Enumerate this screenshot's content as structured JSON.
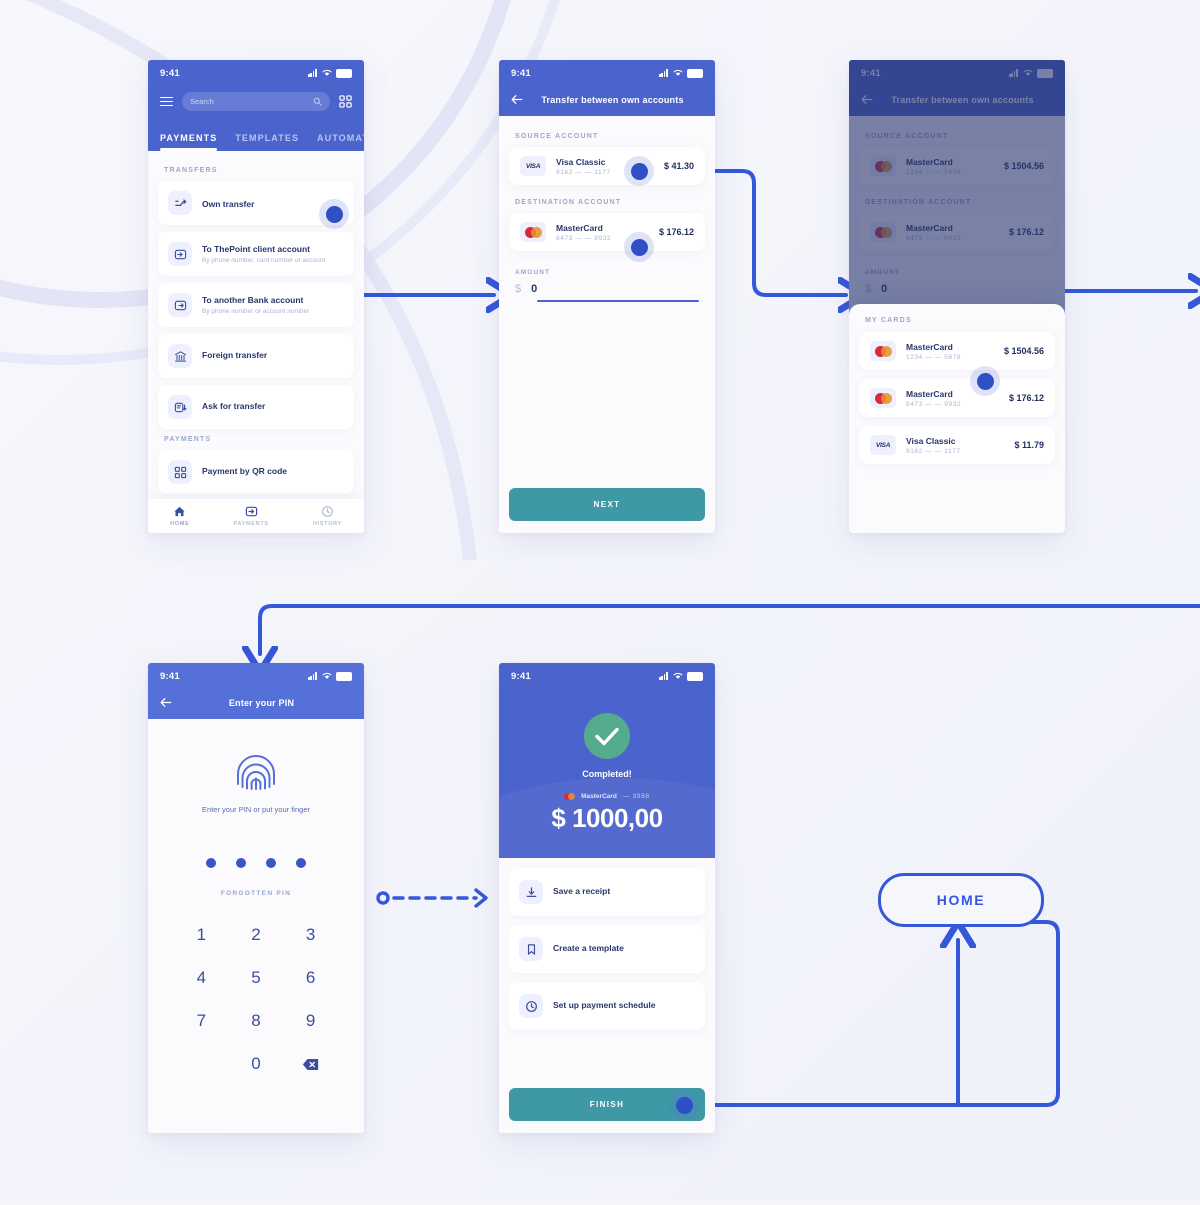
{
  "meta": {
    "accent_blue": "#4b63cc",
    "flow_blue": "#3557d8",
    "teal": "#3f98a5",
    "green": "#55ab8e",
    "bg": "#f4f5fb"
  },
  "status_bar": {
    "time": "9:41"
  },
  "screen1": {
    "search_placeholder": "Search",
    "tabs": [
      {
        "label": "PAYMENTS",
        "active": true
      },
      {
        "label": "TEMPLATES",
        "active": false
      },
      {
        "label": "AUTOMATIC",
        "active": false
      }
    ],
    "section_transfers": "TRANSFERS",
    "transfers": [
      {
        "title": "Own transfer",
        "subtitle": ""
      },
      {
        "title": "To ThePoint client account",
        "subtitle": "By phone number, card number or account"
      },
      {
        "title": "To another Bank account",
        "subtitle": "By phone number or account number"
      },
      {
        "title": "Foreign transfer",
        "subtitle": ""
      },
      {
        "title": "Ask for transfer",
        "subtitle": ""
      }
    ],
    "section_payments": "PAYMENTS",
    "payments": [
      {
        "title": "Payment by QR code",
        "subtitle": ""
      }
    ],
    "bottom_nav": [
      {
        "label": "HOME",
        "icon": "home-icon"
      },
      {
        "label": "PAYMENTS",
        "icon": "payments-icon"
      },
      {
        "label": "HISTORY",
        "icon": "history-icon"
      }
    ]
  },
  "screen2": {
    "title": "Transfer between own accounts",
    "source_label": "SOURCE ACCOUNT",
    "source": {
      "brand": "Visa Classic",
      "number": "9182 — — 1177",
      "amount": "$ 41.30",
      "logo": "visa"
    },
    "destination_label": "DESTINATION ACCOUNT",
    "destination": {
      "brand": "MasterCard",
      "number": "8473 — — 9932",
      "amount": "$ 176.12",
      "logo": "mastercard"
    },
    "amount_label": "AMOUNT",
    "amount_currency": "$",
    "amount_value": "0",
    "next_button": "NEXT"
  },
  "screen3": {
    "title": "Transfer between own accounts",
    "source_label": "SOURCE ACCOUNT",
    "source": {
      "brand": "MasterCard",
      "number": "1234 — — 5678",
      "amount": "$ 1504.56",
      "logo": "mastercard"
    },
    "destination_label": "DESTINATION ACCOUNT",
    "destination": {
      "brand": "MasterCard",
      "number": "8473 — — 9932",
      "amount": "$ 176.12",
      "logo": "mastercard"
    },
    "amount_label": "AMOUNT",
    "amount_currency": "$",
    "amount_value": "0",
    "sheet_title": "MY CARDS",
    "cards": [
      {
        "brand": "MasterCard",
        "number": "1234 — — 5678",
        "amount": "$ 1504.56",
        "logo": "mastercard",
        "selected": true
      },
      {
        "brand": "MasterCard",
        "number": "8473 — — 9932",
        "amount": "$ 176.12",
        "logo": "mastercard",
        "selected": false
      },
      {
        "brand": "Visa Classic",
        "number": "9182 — — 1177",
        "amount": "$ 11.79",
        "logo": "visa",
        "selected": false
      }
    ]
  },
  "screen4": {
    "title": "Enter your PIN",
    "hint": "Enter your PIN or put your finger",
    "forgotten": "FORGOTTEN PIN",
    "pin_dots": 4,
    "keys": [
      "1",
      "2",
      "3",
      "4",
      "5",
      "6",
      "7",
      "8",
      "9",
      "",
      "0",
      "backspace"
    ]
  },
  "screen5": {
    "status": "Completed!",
    "card_brand": "MasterCard",
    "card_number": "— 3988",
    "amount": "$ 1000,00",
    "actions": [
      {
        "label": "Save a receipt",
        "icon": "download-icon"
      },
      {
        "label": "Create a template",
        "icon": "bookmark-icon"
      },
      {
        "label": "Set up payment schedule",
        "icon": "clock-icon"
      }
    ],
    "finish_button": "FINISH"
  },
  "flow": {
    "home_label": "HOME"
  }
}
